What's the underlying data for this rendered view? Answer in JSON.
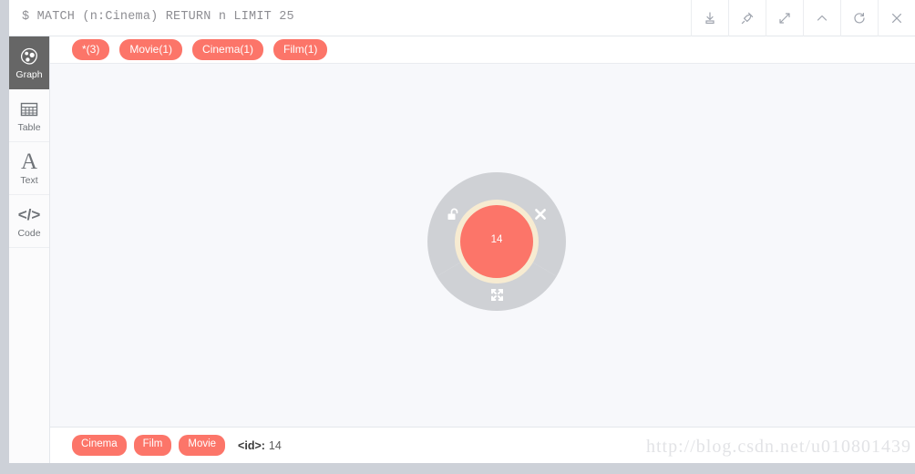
{
  "query_bar": {
    "prompt": "$",
    "query": "$ MATCH (n:Cinema) RETURN n LIMIT 25",
    "tools": [
      {
        "name": "download-icon",
        "label": "Download"
      },
      {
        "name": "pin-icon",
        "label": "Pin"
      },
      {
        "name": "expand-icon",
        "label": "Expand"
      },
      {
        "name": "chevron-up-icon",
        "label": "Collapse"
      },
      {
        "name": "refresh-icon",
        "label": "Refresh"
      },
      {
        "name": "close-icon",
        "label": "Close"
      }
    ]
  },
  "sidebar": {
    "items": [
      {
        "label": "Graph",
        "icon": "graph-icon",
        "active": true
      },
      {
        "label": "Table",
        "icon": "table-icon",
        "active": false
      },
      {
        "label": "Text",
        "icon": "text-icon",
        "active": false
      },
      {
        "label": "Code",
        "icon": "code-icon",
        "active": false
      }
    ]
  },
  "pill_row": {
    "pills": [
      {
        "label": "*(3)"
      },
      {
        "label": "Movie(1)"
      },
      {
        "label": "Cinema(1)"
      },
      {
        "label": "Film(1)"
      }
    ]
  },
  "graph": {
    "node": {
      "caption": "14",
      "node_color": "#FC7569",
      "halo_color": "#F7EBD1",
      "ring_color": "#CFD1D5"
    },
    "ring_actions": [
      {
        "name": "unlock-icon",
        "label": "Unlock"
      },
      {
        "name": "dismiss-icon",
        "label": "Dismiss"
      },
      {
        "name": "expand-node-icon",
        "label": "Expand"
      }
    ]
  },
  "detail_bar": {
    "labels": [
      "Cinema",
      "Film",
      "Movie"
    ],
    "id_key": "<id>:",
    "id_value": "14"
  },
  "watermark": {
    "text": "http://blog.csdn.net/u010801439"
  },
  "colors": {
    "accent": "#FC7569",
    "sidebar_active": "#666666",
    "canvas": "#F7F8FB",
    "page": "#CDD1D8"
  }
}
